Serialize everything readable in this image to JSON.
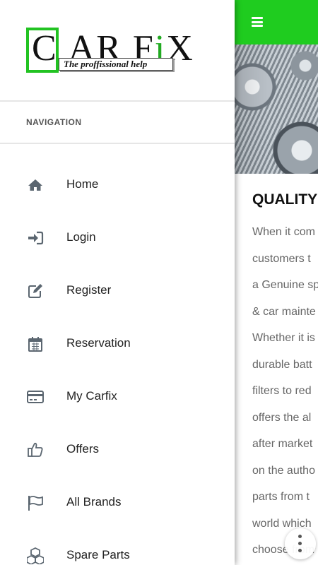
{
  "drawer": {
    "brand": {
      "logo_text": "CAR FIX",
      "tagline": "The proffissional help"
    },
    "section_title": "NAVIGATION",
    "items": [
      {
        "label": "Home",
        "icon": "home-icon"
      },
      {
        "label": "Login",
        "icon": "sign-in-icon"
      },
      {
        "label": "Register",
        "icon": "edit-icon"
      },
      {
        "label": "Reservation",
        "icon": "calendar-icon"
      },
      {
        "label": "My Carfix",
        "icon": "credit-card-icon"
      },
      {
        "label": "Offers",
        "icon": "thumbs-up-icon"
      },
      {
        "label": "All Brands",
        "icon": "flag-icon"
      },
      {
        "label": "Spare Parts",
        "icon": "cubes-icon"
      }
    ]
  },
  "page": {
    "heading": "QUALITY",
    "paragraph_lines": [
      "When it com",
      "customers t",
      "a Genuine sp",
      "& car mainte",
      "Whether it is",
      "durable batt",
      "filters to red",
      "offers the al",
      "after market",
      "on the autho",
      "parts from t",
      "world which",
      "choose from"
    ]
  },
  "colors": {
    "accent_green": "#1fcc1f",
    "text_dark": "#222222",
    "text_muted": "#666666"
  }
}
